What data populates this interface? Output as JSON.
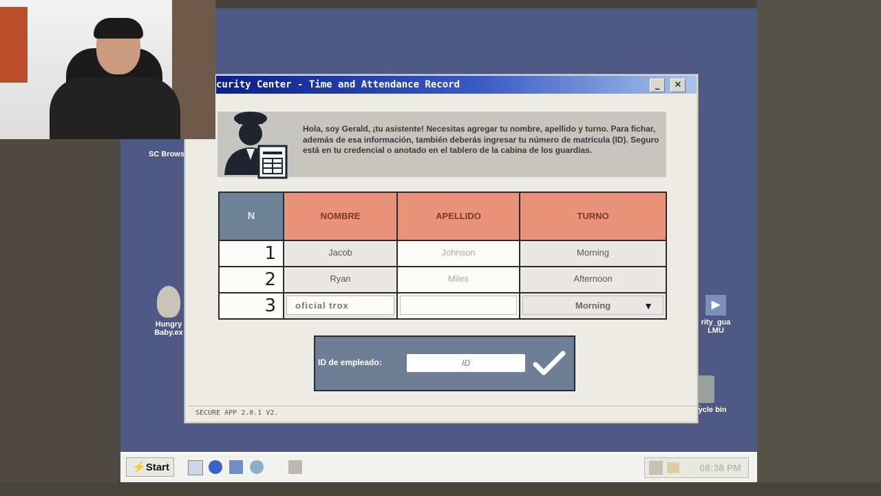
{
  "window": {
    "title": "curity Center - Time and Attendance Record",
    "minimize_glyph": "_",
    "close_glyph": "✕",
    "assistant_message": "Hola, soy Gerald, ¡tu asistente! Necesitas agregar tu nombre, apellido y turno. Para fichar, además de esa información, también deberás ingresar tu número de matrícula (ID). Seguro está en tu credencial o anotado en el tablero de la cabina de los guardias.",
    "status": "SECURE APP 2.0.1 V2."
  },
  "table": {
    "headers": [
      "N",
      "NOMBRE",
      "APELLIDO",
      "TURNO"
    ],
    "rows": [
      {
        "n": "1",
        "nombre": "Jacob",
        "apellido": "Johnson",
        "turno": "Morning"
      },
      {
        "n": "2",
        "nombre": "Ryan",
        "apellido": "Miles",
        "turno": "Afternoon"
      }
    ],
    "entry": {
      "n": "3",
      "nombre": "oficial trox",
      "apellido": "",
      "turno": "Morning"
    }
  },
  "id_panel": {
    "label": "ID de empleado:",
    "placeholder": "ID"
  },
  "desktop": {
    "icons": [
      {
        "label": "SC Brows"
      },
      {
        "label": "Hungry Baby.ex"
      },
      {
        "label": "rity_gua LMU"
      },
      {
        "label": "Recycle bin"
      }
    ]
  },
  "taskbar": {
    "start_label": "Start",
    "clock": "08:38 PM"
  },
  "colors": {
    "header_orange": "#e8937a",
    "header_blue": "#6e8298",
    "desktop_blue": "#4d5885"
  }
}
